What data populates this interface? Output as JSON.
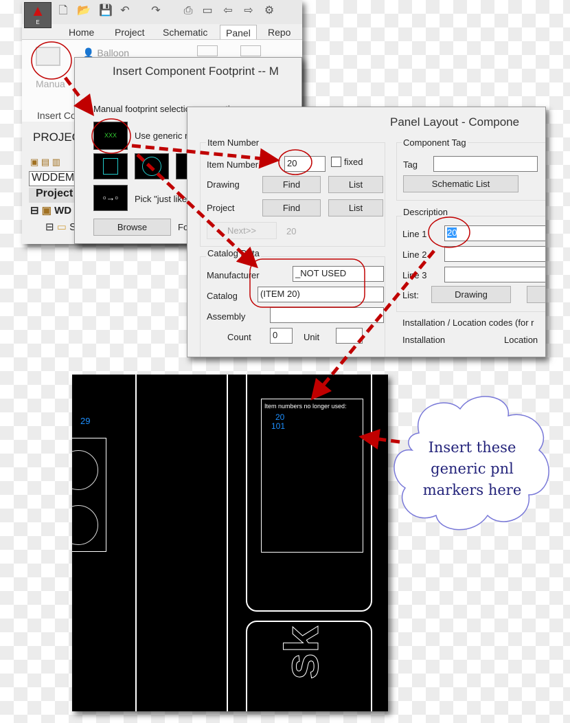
{
  "app": {
    "app_button_letter": "E",
    "tabs": [
      "Home",
      "Project",
      "Schematic",
      "Panel",
      "Repo"
    ],
    "active_tab": "Panel",
    "ribbon": {
      "manual_label": "Manua",
      "balloon_label": "Balloon",
      "insert_panel_label": "Insert Co"
    },
    "project_palette": {
      "title": "PROJEC",
      "project_select": "WDDEM",
      "header": "Project",
      "tree": [
        "WD",
        "S"
      ]
    }
  },
  "footprint_dialog": {
    "title": "Insert Component Footprint -- M",
    "section": "Manual footprint selection or creation",
    "generic_label": "Use generic m",
    "thumb_text": "XXX",
    "pick_label": "Pick \"just like\"",
    "browse": "Browse",
    "fo_label": "Fo"
  },
  "panel_dialog": {
    "title": "Panel Layout - Compone",
    "item_number": {
      "group": "Item Number",
      "label": "Item Number",
      "value": "20",
      "fixed_label": "fixed",
      "fixed_checked": false,
      "drawing_label": "Drawing",
      "project_label": "Project",
      "find": "Find",
      "list": "List",
      "next": "Next>>",
      "next_value": "20"
    },
    "catalog": {
      "group": "Catalog Data",
      "manufacturer_label": "Manufacturer",
      "manufacturer": "_NOT USED",
      "catalog_label": "Catalog",
      "catalog": "(ITEM 20)",
      "assembly_label": "Assembly",
      "assembly": "",
      "count_label": "Count",
      "count": "0",
      "unit_label": "Unit",
      "unit": ""
    },
    "component_tag": {
      "group": "Component Tag",
      "tag_label": "Tag",
      "tag": "",
      "schematic_list": "Schematic List"
    },
    "description": {
      "group": "Description",
      "line1_label": "Line 1",
      "line1": "20",
      "line2_label": "Line 2",
      "line2": "",
      "line3_label": "Line 3",
      "line3": "",
      "list_label": "List:",
      "drawing": "Drawing"
    },
    "install": {
      "group": "Installation / Location codes  (for r",
      "installation_label": "Installation",
      "location_label": "Location"
    }
  },
  "cad": {
    "box_title": "Item numbers no longer used:",
    "unused_items": [
      "20",
      "101"
    ],
    "left_number": "29",
    "logo_text": "sk",
    "text_color": "#1e90ff"
  },
  "callout": {
    "text": "Insert these generic pnl markers here"
  },
  "colors": {
    "annotation_red": "#c00000",
    "highlight": "#3399ff"
  }
}
